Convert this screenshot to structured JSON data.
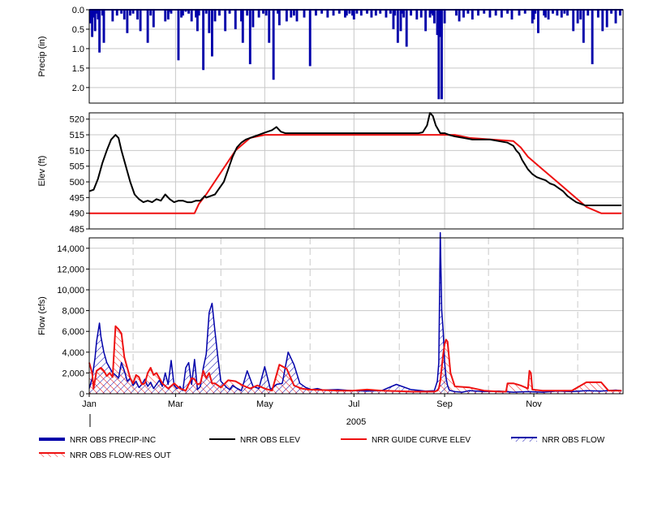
{
  "chart_data": [
    {
      "type": "bar",
      "ylabel": "Precip (in)",
      "ylim": [
        2.4,
        0.0
      ],
      "yticks": [
        0.0,
        0.5,
        1.0,
        1.5,
        2.0
      ],
      "ytick_labels": [
        "0.0",
        "0.5",
        "1.0",
        "1.5",
        "2.0"
      ],
      "grid": true,
      "series": [
        {
          "name": "NRR OBS PRECIP-INC",
          "color": "#0000aa",
          "x": [
            1,
            2,
            3,
            4,
            5,
            6,
            7,
            9,
            10,
            16,
            19,
            22,
            24,
            26,
            28,
            30,
            33,
            35,
            40,
            42,
            44,
            52,
            54,
            55,
            56,
            61,
            63,
            64,
            66,
            68,
            70,
            73,
            74,
            75,
            78,
            80,
            82,
            84,
            86,
            89,
            93,
            96,
            100,
            104,
            105,
            108,
            110,
            112,
            116,
            119,
            121,
            123,
            126,
            129,
            130,
            135,
            138,
            140,
            142,
            147,
            151,
            155,
            159,
            163,
            167,
            171,
            175,
            176,
            178,
            180,
            181,
            183,
            186,
            190,
            193,
            196,
            199,
            203,
            206,
            208,
            209,
            211,
            213,
            214,
            215,
            217,
            220,
            224,
            227,
            230,
            233,
            234,
            235,
            236,
            238,
            239,
            240,
            241,
            243,
            251,
            253,
            256,
            259,
            262,
            266,
            270,
            274,
            278,
            282,
            286,
            289,
            294,
            298,
            303,
            304,
            305,
            307,
            311,
            312,
            314,
            317,
            320,
            323,
            325,
            327,
            331,
            334,
            336,
            338,
            341,
            344,
            348,
            351,
            354,
            357,
            360,
            363
          ],
          "values": [
            0.35,
            0.7,
            0.2,
            0.55,
            0.1,
            0.25,
            1.1,
            0.15,
            0.85,
            0.3,
            0.15,
            0.1,
            0.25,
            0.6,
            0.15,
            0.1,
            0.25,
            0.55,
            0.85,
            0.15,
            0.45,
            0.3,
            0.25,
            0.05,
            0.1,
            1.3,
            0.2,
            0.15,
            0.05,
            0.1,
            0.3,
            0.2,
            0.55,
            0.15,
            1.55,
            0.1,
            0.6,
            1.2,
            0.3,
            0.15,
            0.55,
            0.1,
            0.5,
            0.3,
            0.85,
            0.15,
            1.4,
            0.45,
            0.2,
            0.1,
            0.15,
            0.85,
            1.8,
            0.1,
            0.4,
            0.3,
            0.2,
            0.15,
            0.3,
            0.2,
            1.45,
            0.15,
            0.1,
            0.2,
            0.15,
            0.1,
            0.2,
            0.15,
            0.1,
            0.15,
            0.25,
            0.1,
            0.15,
            0.1,
            0.2,
            0.15,
            0.1,
            0.2,
            0.1,
            0.5,
            0.15,
            0.85,
            0.55,
            0.1,
            0.2,
            0.95,
            0.15,
            0.25,
            0.2,
            0.55,
            0.2,
            0.1,
            0.15,
            0.35,
            0.65,
            2.3,
            0.7,
            2.3,
            0.35,
            0.15,
            0.3,
            0.2,
            0.1,
            0.25,
            0.15,
            0.1,
            0.2,
            0.15,
            0.2,
            0.1,
            0.25,
            0.15,
            0.1,
            0.35,
            0.25,
            0.1,
            0.6,
            0.15,
            0.2,
            0.25,
            0.1,
            0.15,
            0.2,
            0.1,
            0.15,
            0.55,
            0.35,
            0.25,
            0.85,
            0.15,
            1.4,
            0.2,
            0.55,
            0.45,
            0.1,
            0.35,
            0.15
          ]
        }
      ]
    },
    {
      "type": "line",
      "ylabel": "Elev (ft)",
      "ylim": [
        485,
        522
      ],
      "yticks": [
        485,
        490,
        495,
        500,
        505,
        510,
        515,
        520
      ],
      "ytick_labels": [
        "485",
        "490",
        "495",
        "500",
        "505",
        "510",
        "515",
        "520"
      ],
      "grid": true,
      "series": [
        {
          "name": "NRR OBS ELEV",
          "color": "#000000",
          "x": [
            0,
            3,
            6,
            9,
            12,
            15,
            18,
            20,
            22,
            25,
            28,
            31,
            34,
            37,
            40,
            43,
            46,
            49,
            52,
            55,
            58,
            61,
            64,
            67,
            70,
            73,
            76,
            79,
            80,
            83,
            86,
            89,
            92,
            95,
            98,
            101,
            104,
            107,
            110,
            113,
            116,
            119,
            122,
            125,
            128,
            131,
            134,
            137,
            140,
            150,
            160,
            170,
            180,
            190,
            200,
            210,
            220,
            225,
            228,
            231,
            233,
            235,
            237,
            240,
            243,
            246,
            250,
            256,
            262,
            268,
            274,
            280,
            286,
            290,
            292,
            294,
            296,
            298,
            300,
            303,
            306,
            309,
            312,
            315,
            318,
            321,
            324,
            327,
            330,
            333,
            336,
            339,
            342,
            345,
            348,
            351,
            354,
            357,
            360,
            364
          ],
          "y": [
            497,
            497.5,
            501,
            506,
            510,
            513.5,
            515,
            514,
            510,
            505,
            500,
            496,
            494.5,
            493.5,
            494,
            493.5,
            494.5,
            494,
            496,
            494.5,
            493.5,
            494,
            494,
            493.5,
            493.5,
            494,
            494,
            495.5,
            495,
            495.5,
            496,
            498,
            500,
            504,
            508,
            511,
            512.5,
            513.5,
            514,
            514.5,
            515,
            515.5,
            516,
            516.5,
            517.5,
            516,
            515.5,
            515.5,
            515.5,
            515.5,
            515.5,
            515.5,
            515.5,
            515.5,
            515.5,
            515.5,
            515.5,
            515.5,
            515.8,
            518,
            522,
            521,
            518,
            515.5,
            515.5,
            515,
            514.5,
            514,
            513.5,
            513.5,
            513.5,
            513,
            512.5,
            511.5,
            510,
            509,
            507,
            505.5,
            504,
            502.5,
            501.5,
            501,
            500.5,
            499.5,
            499,
            498,
            497,
            495.5,
            494.5,
            493.5,
            493,
            492.5,
            492.5,
            492.5,
            492.5,
            492.5,
            492.5,
            492.5,
            492.5,
            492.5
          ]
        },
        {
          "name": "NRR GUIDE CURVE ELEV",
          "color": "#ee1111",
          "x": [
            0,
            72,
            75,
            80,
            90,
            100,
            110,
            120,
            130,
            140,
            200,
            240,
            250,
            260,
            290,
            295,
            300,
            310,
            320,
            330,
            340,
            350,
            364
          ],
          "y": [
            490,
            490,
            493,
            496,
            503,
            510,
            514,
            515,
            515,
            515,
            515,
            515,
            515,
            514,
            513,
            511,
            508,
            504,
            500,
            496,
            492,
            490,
            490
          ]
        }
      ]
    },
    {
      "type": "area",
      "ylabel": "Flow (cfs)",
      "xlabel": "2005",
      "ylim": [
        0,
        15000
      ],
      "yticks": [
        0,
        2000,
        4000,
        6000,
        8000,
        10000,
        12000,
        14000
      ],
      "ytick_labels": [
        "0",
        "2,000",
        "4,000",
        "6,000",
        "8,000",
        "10,000",
        "12,000",
        "14,000"
      ],
      "x_ticks": [
        0,
        59,
        120,
        181,
        243,
        304
      ],
      "x_tick_labels": [
        "Jan",
        "Mar",
        "May",
        "Jul",
        "Sep",
        "Nov"
      ],
      "x_grid": [
        30,
        90,
        151,
        212,
        273,
        334
      ],
      "xlim": [
        0,
        365
      ],
      "grid": true,
      "series": [
        {
          "name": "NRR OBS FLOW",
          "color": "#0000aa",
          "x": [
            0,
            2,
            4,
            5,
            7,
            8,
            10,
            12,
            14,
            16,
            18,
            20,
            22,
            24,
            26,
            28,
            30,
            32,
            34,
            36,
            38,
            40,
            42,
            44,
            46,
            48,
            50,
            52,
            54,
            56,
            58,
            60,
            62,
            64,
            66,
            68,
            70,
            72,
            74,
            76,
            78,
            80,
            82,
            84,
            86,
            88,
            90,
            92,
            94,
            96,
            98,
            100,
            104,
            108,
            112,
            116,
            120,
            124,
            128,
            132,
            136,
            140,
            144,
            148,
            152,
            156,
            160,
            170,
            180,
            190,
            200,
            210,
            220,
            230,
            236,
            238,
            239,
            240,
            241,
            242,
            243,
            244,
            245,
            246,
            247,
            250,
            255,
            260,
            270,
            280,
            290,
            300,
            310,
            320,
            330,
            340,
            350,
            360,
            364
          ],
          "y": [
            500,
            1500,
            3500,
            5000,
            6800,
            5500,
            4000,
            3000,
            2500,
            2000,
            1800,
            1500,
            3000,
            2200,
            1200,
            1500,
            800,
            1200,
            600,
            900,
            1400,
            700,
            1100,
            500,
            900,
            1300,
            700,
            2000,
            900,
            3200,
            800,
            500,
            700,
            300,
            2500,
            3000,
            900,
            3300,
            400,
            700,
            2500,
            3800,
            7800,
            8700,
            6000,
            3500,
            1200,
            900,
            600,
            400,
            800,
            600,
            300,
            2200,
            700,
            500,
            2600,
            400,
            900,
            1000,
            4000,
            2800,
            1000,
            600,
            400,
            500,
            350,
            400,
            300,
            250,
            300,
            900,
            400,
            250,
            300,
            1200,
            3000,
            15500,
            8000,
            6000,
            3000,
            1500,
            800,
            400,
            300,
            200,
            150,
            300,
            200,
            250,
            150,
            200,
            150,
            250,
            200,
            300,
            250,
            350,
            300
          ]
        },
        {
          "name": "NRR OBS FLOW-RES OUT",
          "color": "#ee1111",
          "x": [
            0,
            2,
            3,
            5,
            8,
            10,
            12,
            14,
            16,
            18,
            20,
            22,
            24,
            26,
            28,
            30,
            32,
            34,
            36,
            38,
            40,
            42,
            44,
            46,
            48,
            50,
            54,
            58,
            62,
            66,
            70,
            72,
            74,
            76,
            78,
            80,
            82,
            84,
            86,
            88,
            90,
            95,
            100,
            105,
            110,
            115,
            120,
            125,
            130,
            135,
            140,
            145,
            150,
            160,
            170,
            180,
            190,
            200,
            210,
            220,
            230,
            236,
            238,
            239,
            240,
            241,
            242,
            243,
            244,
            245,
            246,
            247,
            250,
            260,
            270,
            280,
            285,
            286,
            290,
            295,
            300,
            301,
            302,
            303,
            310,
            320,
            330,
            340,
            350,
            355,
            360,
            364
          ],
          "y": [
            3000,
            2000,
            500,
            2200,
            2500,
            2200,
            1700,
            2000,
            1600,
            6500,
            6200,
            5800,
            3500,
            2500,
            1500,
            1000,
            1800,
            1600,
            900,
            1000,
            2000,
            2500,
            1800,
            2000,
            1500,
            1000,
            500,
            1000,
            500,
            300,
            1500,
            1400,
            900,
            1000,
            2200,
            1500,
            2000,
            1000,
            1000,
            800,
            600,
            1300,
            1200,
            800,
            500,
            800,
            500,
            300,
            2800,
            2400,
            800,
            500,
            400,
            350,
            300,
            300,
            400,
            300,
            250,
            200,
            200,
            200,
            300,
            500,
            1200,
            2500,
            3800,
            4800,
            5200,
            5000,
            3500,
            2000,
            700,
            600,
            300,
            200,
            200,
            1000,
            1000,
            800,
            500,
            2200,
            2000,
            400,
            300,
            300,
            300,
            1100,
            1100,
            300,
            300,
            300
          ]
        }
      ]
    }
  ],
  "legend": [
    {
      "label": "NRR OBS PRECIP-INC",
      "color": "#0000aa",
      "style": "thick-line"
    },
    {
      "label": "NRR OBS ELEV",
      "color": "#000000",
      "style": "line"
    },
    {
      "label": "NRR GUIDE CURVE ELEV",
      "color": "#ee1111",
      "style": "line"
    },
    {
      "label": "NRR OBS FLOW",
      "color": "#0000aa",
      "style": "hatched"
    },
    {
      "label": "NRR OBS FLOW-RES OUT",
      "color": "#ee1111",
      "style": "hatched"
    }
  ]
}
